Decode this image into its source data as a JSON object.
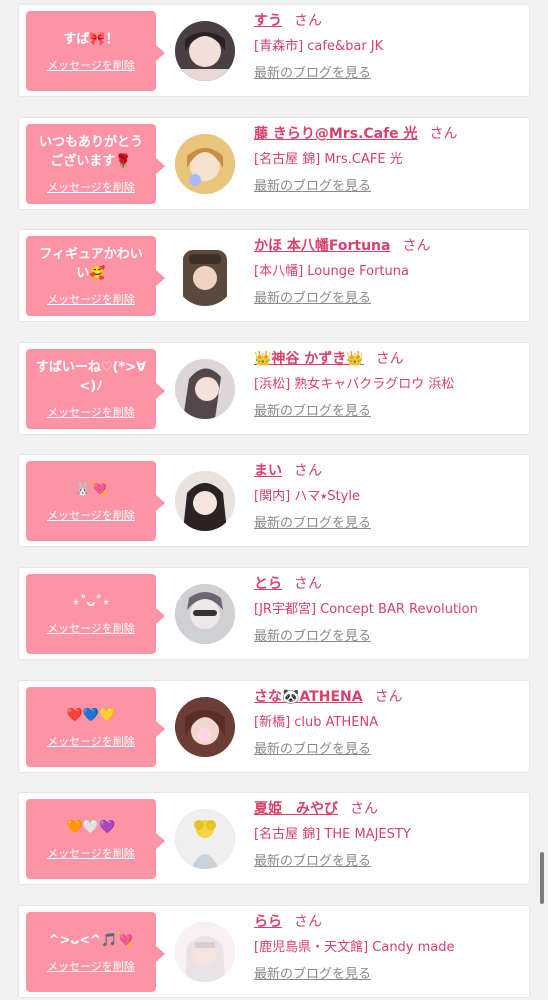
{
  "common": {
    "delete_label": "メッセージを削除",
    "san_label": "さん",
    "blog_label": "最新のブログを見る"
  },
  "colors": {
    "bubble": "#fd94a6",
    "accent": "#d9406a",
    "muted": "#8a8a8a"
  },
  "entries": [
    {
      "message": "すば🎀！",
      "name": "すう",
      "shop": "[青森市] cafe&bar JK"
    },
    {
      "message": "いつもありがとうございます🌹",
      "name": "藤 きらり@Mrs.Cafe 光",
      "shop": "[名古屋 錦] Mrs.CAFE 光"
    },
    {
      "message": "フィギュアかわいい🥰",
      "name": "かほ 本八幡Fortuna",
      "shop": "[本八幡] Lounge Fortuna"
    },
    {
      "message": "すばいーね♡(*>∀<)ﾉ",
      "name": "👑神谷 かずき👑",
      "shop": "[浜松] 熟女キャバクラグロウ 浜松"
    },
    {
      "message": "🐰💘",
      "name": "まい",
      "shop": "[関内] ハマ⭑Style"
    },
    {
      "message": "⋆˚ᴗ˚⋆",
      "name": "とら",
      "shop": "[JR宇都宮] Concept BAR Revolution"
    },
    {
      "message": "❤️💙💛",
      "name": "さな🐼ATHENA",
      "shop": "[新橋] club ATHENA"
    },
    {
      "message": "🧡🤍💜",
      "name": "夏姫　みやび",
      "shop": "[名古屋 錦] THE MAJESTY"
    },
    {
      "message": "^>ᴗ<^🎵💘",
      "name": "らら",
      "shop": "[鹿児島県・天文館] Candy made"
    }
  ]
}
